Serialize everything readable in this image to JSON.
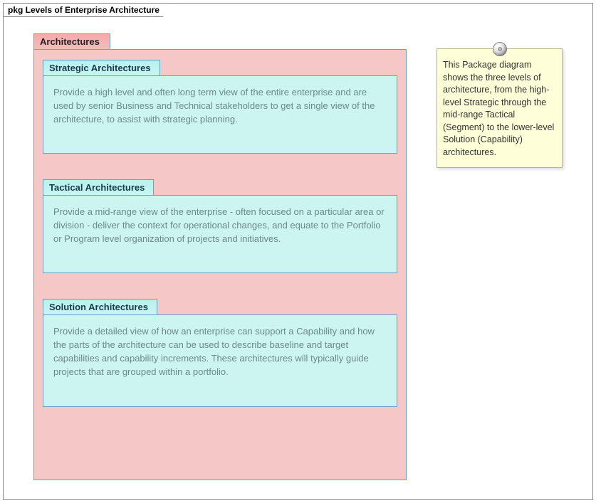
{
  "frame": {
    "title": "pkg Levels of Enterprise Architecture"
  },
  "architectures": {
    "title": "Architectures",
    "packages": [
      {
        "title": "Strategic Architectures",
        "description": "Provide a high level and often long term view of the entire enterprise and are used by senior Business and Technical stakeholders to get a single view of the architecture, to assist with strategic planning."
      },
      {
        "title": "Tactical Architectures",
        "description": "Provide a mid-range view of the enterprise - often focused on a particular area or division - deliver the context for operational changes, and equate to the Portfolio or Program level organization of projects and initiatives."
      },
      {
        "title": "Solution Architectures",
        "description": "Provide a detailed view of how an enterprise can support a Capability and how the parts of the architecture can be used to describe baseline and target capabilities and capability increments. These architectures will typically guide projects that are grouped within a portfolio."
      }
    ]
  },
  "note": {
    "text": "This Package diagram shows the three levels of architecture, from the high-level Strategic through the mid-range Tactical (Segment) to the lower-level Solution (Capability) architectures."
  }
}
